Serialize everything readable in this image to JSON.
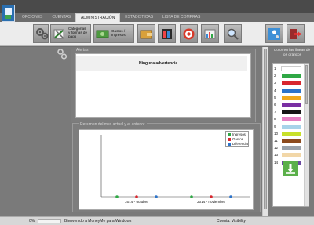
{
  "tabs": [
    {
      "label": "OPCIONES"
    },
    {
      "label": "CUENTAS"
    },
    {
      "label": "ADMINISTRACIÓN"
    },
    {
      "label": "ESTADISTICAS"
    },
    {
      "label": "LISTA DE COMPRAS"
    }
  ],
  "ribbon": {
    "categories_label": "Categorías y formas de pago",
    "expenses_label": "Gastos / Ingresos"
  },
  "alerts": {
    "title": "Alertas",
    "message": "Ninguna advertencia"
  },
  "summary": {
    "title": "Resumen del mes actual y el anterior"
  },
  "colors_panel": {
    "title": "Color en las líneas de los gráficos",
    "rows": [
      {
        "num": "1",
        "color": "#ffffff"
      },
      {
        "num": "2",
        "color": "#2fa845"
      },
      {
        "num": "3",
        "color": "#d8262e"
      },
      {
        "num": "4",
        "color": "#2c73c9"
      },
      {
        "num": "5",
        "color": "#f0a81c"
      },
      {
        "num": "6",
        "color": "#7a2fa3"
      },
      {
        "num": "7",
        "color": "#151515"
      },
      {
        "num": "8",
        "color": "#e57ec1"
      },
      {
        "num": "9",
        "color": "#a7d3e9"
      },
      {
        "num": "10",
        "color": "#c8e02a"
      },
      {
        "num": "11",
        "color": "#8c4b1f"
      },
      {
        "num": "12",
        "color": "#9aa2ab"
      },
      {
        "num": "13",
        "color": "#f2d7a8"
      },
      {
        "num": "14",
        "color": "#6b4aa0"
      }
    ]
  },
  "chart_data": {
    "type": "line",
    "categories": [
      "2014 - octubre",
      "2014 - noviembre"
    ],
    "series": [
      {
        "name": "Ingresos",
        "color": "#2fa845",
        "values": [
          0,
          0
        ]
      },
      {
        "name": "Gastos",
        "color": "#d8262e",
        "values": [
          0,
          0
        ]
      },
      {
        "name": "Diferencia",
        "color": "#2c73c9",
        "values": [
          0,
          0
        ]
      }
    ],
    "legend": "top-right"
  },
  "status": {
    "progress_text": "0%",
    "progress": 0,
    "message": "Bienvenido a MoneyMe para Windows",
    "account": "Cuenta: Visibility"
  }
}
